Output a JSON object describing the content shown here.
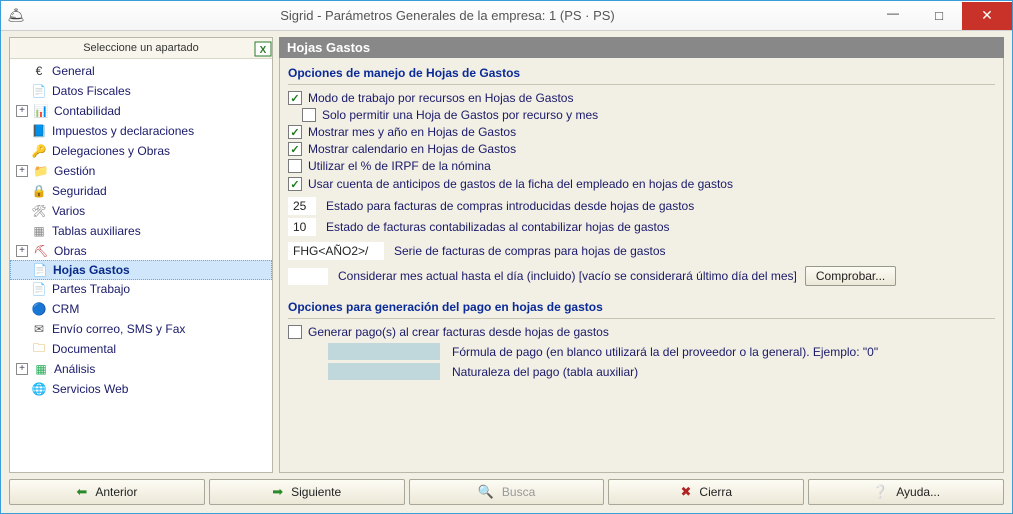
{
  "window": {
    "title": "Sigrid - Parámetros Generales de la empresa: 1 (PS · PS)"
  },
  "sidebar": {
    "header": "Seleccione un apartado",
    "items": [
      {
        "id": "general",
        "label": "General",
        "level": 0,
        "exp": "",
        "icon": "€",
        "color": "#333"
      },
      {
        "id": "datos-fiscales",
        "label": "Datos Fiscales",
        "level": 0,
        "exp": "",
        "icon": "📄",
        "color": "#7a3"
      },
      {
        "id": "contabilidad",
        "label": "Contabilidad",
        "level": 0,
        "exp": "+",
        "icon": "📊",
        "color": "#7a3"
      },
      {
        "id": "impuestos",
        "label": "Impuestos y declaraciones",
        "level": 1,
        "exp": "",
        "icon": "📘",
        "color": "#58b"
      },
      {
        "id": "delegaciones",
        "label": "Delegaciones y Obras",
        "level": 0,
        "exp": "",
        "icon": "🔑",
        "color": "#c80"
      },
      {
        "id": "gestion",
        "label": "Gestión",
        "level": 0,
        "exp": "+",
        "icon": "📁",
        "color": "#c80"
      },
      {
        "id": "seguridad",
        "label": "Seguridad",
        "level": 1,
        "exp": "",
        "icon": "🔒",
        "color": "#c80"
      },
      {
        "id": "varios",
        "label": "Varios",
        "level": 1,
        "exp": "",
        "icon": "🛠",
        "color": "#777"
      },
      {
        "id": "tablas-aux",
        "label": "Tablas auxiliares",
        "level": 1,
        "exp": "",
        "icon": "▦",
        "color": "#888"
      },
      {
        "id": "obras",
        "label": "Obras",
        "level": 0,
        "exp": "+",
        "icon": "⛏",
        "color": "#b33"
      },
      {
        "id": "hojas-gastos",
        "label": "Hojas Gastos",
        "level": 1,
        "exp": "",
        "icon": "📄",
        "color": "#2a6",
        "selected": true
      },
      {
        "id": "partes-trabajo",
        "label": "Partes Trabajo",
        "level": 1,
        "exp": "",
        "icon": "📄",
        "color": "#c80"
      },
      {
        "id": "crm",
        "label": "CRM",
        "level": 1,
        "exp": "",
        "icon": "🔵",
        "color": "#06c"
      },
      {
        "id": "envio",
        "label": "Envío correo, SMS y Fax",
        "level": 1,
        "exp": "",
        "icon": "✉",
        "color": "#555"
      },
      {
        "id": "documental",
        "label": "Documental",
        "level": 1,
        "exp": "",
        "icon": "🗀",
        "color": "#c80"
      },
      {
        "id": "analisis",
        "label": "Análisis",
        "level": 0,
        "exp": "+",
        "icon": "▦",
        "color": "#2a5"
      },
      {
        "id": "servicios-web",
        "label": "Servicios Web",
        "level": 1,
        "exp": "",
        "icon": "🌐",
        "color": "#2a6"
      }
    ]
  },
  "panel": {
    "title": "Hojas Gastos",
    "section1": {
      "title": "Opciones de manejo de Hojas de Gastos",
      "chk_modo": {
        "checked": true,
        "label": "Modo de trabajo por recursos en Hojas de Gastos"
      },
      "chk_solo": {
        "checked": false,
        "label": "Solo permitir una Hoja de Gastos por recurso y mes"
      },
      "chk_mes": {
        "checked": true,
        "label": "Mostrar mes y año en Hojas de Gastos"
      },
      "chk_cal": {
        "checked": true,
        "label": "Mostrar calendario en Hojas de Gastos"
      },
      "chk_irpf": {
        "checked": false,
        "label": "Utilizar el % de IRPF de la nómina"
      },
      "chk_anticipos": {
        "checked": true,
        "label": "Usar cuenta de anticipos de gastos de la ficha del empleado en hojas de gastos"
      },
      "estado_facturas": {
        "value": "25",
        "label": "Estado para facturas de compras introducidas desde hojas de gastos"
      },
      "estado_contab": {
        "value": "10",
        "label": "Estado de facturas contabilizadas al contabilizar hojas de gastos"
      },
      "serie": {
        "value": "FHG<AÑO2>/",
        "label": "Serie de facturas de compras para hojas de gastos"
      },
      "considerar": {
        "value": "",
        "label": "Considerar mes actual hasta el día (incluido) [vacío se considerará último día del mes]",
        "button": "Comprobar..."
      }
    },
    "section2": {
      "title": "Opciones para generación del pago en hojas de gastos",
      "chk_generar": {
        "checked": false,
        "label": "Generar pago(s) al crear facturas desde hojas de gastos"
      },
      "formula": {
        "value": "",
        "label": "Fórmula de pago (en blanco utilizará la del proveedor o la general). Ejemplo: \"0\""
      },
      "naturaleza": {
        "value": "",
        "label": "Naturaleza del pago (tabla auxiliar)"
      }
    }
  },
  "footer": {
    "anterior": "Anterior",
    "siguiente": "Siguiente",
    "busca": "Busca",
    "cierra": "Cierra",
    "ayuda": "Ayuda..."
  }
}
